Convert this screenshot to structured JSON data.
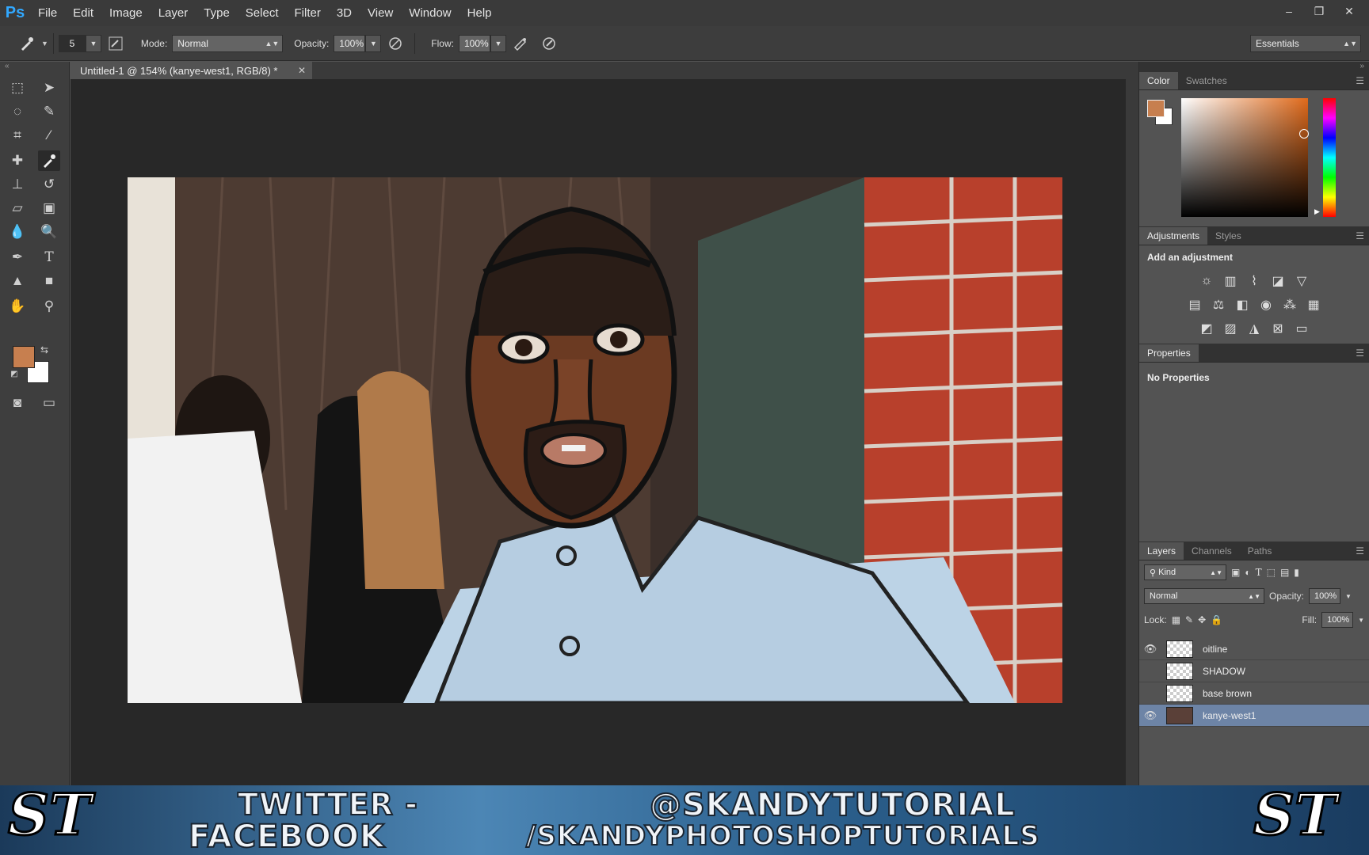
{
  "app": {
    "logo": "Ps"
  },
  "menu": [
    "File",
    "Edit",
    "Image",
    "Layer",
    "Type",
    "Select",
    "Filter",
    "3D",
    "View",
    "Window",
    "Help"
  ],
  "window_controls": {
    "minimize": "–",
    "restore": "❐",
    "close": "✕"
  },
  "options": {
    "brush_size": "5",
    "mode_label": "Mode:",
    "mode_value": "Normal",
    "opacity_label": "Opacity:",
    "opacity_value": "100%",
    "flow_label": "Flow:",
    "flow_value": "100%",
    "workspace": "Essentials"
  },
  "document": {
    "tab_title": "Untitled-1 @ 154% (kanye-west1, RGB/8) *"
  },
  "colors": {
    "foreground": "#c77f4f",
    "background": "#ffffff"
  },
  "color_panel": {
    "tabs": [
      "Color",
      "Swatches"
    ]
  },
  "adjustments_panel": {
    "tabs": [
      "Adjustments",
      "Styles"
    ],
    "title": "Add an adjustment"
  },
  "properties_panel": {
    "title": "Properties",
    "message": "No Properties"
  },
  "layers_panel": {
    "tabs": [
      "Layers",
      "Channels",
      "Paths"
    ],
    "filter": "Kind",
    "blend_mode": "Normal",
    "opacity_label": "Opacity:",
    "opacity_value": "100%",
    "lock_label": "Lock:",
    "fill_label": "Fill:",
    "fill_value": "100%",
    "layers": [
      {
        "name": "oitline",
        "visible": true,
        "selected": false
      },
      {
        "name": "SHADOW",
        "visible": false,
        "selected": false
      },
      {
        "name": "base brown",
        "visible": false,
        "selected": false
      },
      {
        "name": "kanye-west1",
        "visible": true,
        "selected": true
      }
    ]
  },
  "banner": {
    "line1_left": "TWITTER -",
    "line1_right": "@SKANDYTUTORIAL",
    "line2_left": "FACEBOOK",
    "line2_right": "/SKANDYPHOTOSHOPTUTORIALS",
    "logo": "ST"
  }
}
